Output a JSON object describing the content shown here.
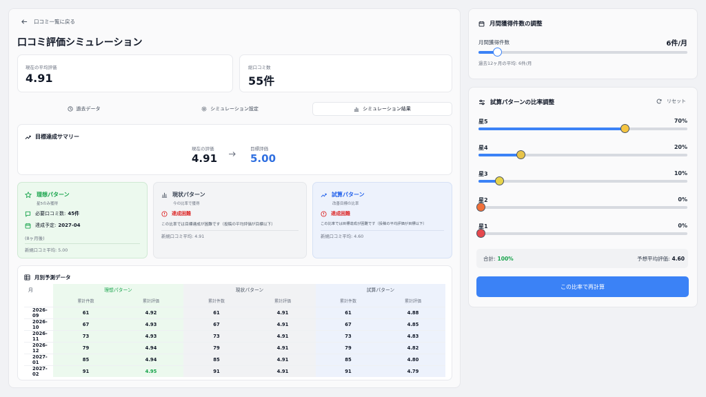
{
  "header": {
    "back_label": "口コミ一覧に戻る",
    "page_title": "口コミ評価シミュレーション"
  },
  "stats": {
    "avg_label": "現在の平均評価",
    "avg_value": "4.91",
    "total_label": "総口コミ数",
    "total_value": "55件"
  },
  "tabs": [
    {
      "label": "過去データ",
      "icon": "history-icon"
    },
    {
      "label": "シミュレーション設定",
      "icon": "gear-icon"
    },
    {
      "label": "シミュレーション結果",
      "icon": "bar-chart-icon",
      "active": true
    }
  ],
  "summary": {
    "title": "目標達成サマリー",
    "current_label": "現在の評価",
    "current_value": "4.91",
    "target_label": "目標評価",
    "target_value": "5.00"
  },
  "patterns": {
    "ideal": {
      "title": "理想パターン",
      "subtitle": "星5のみ獲得",
      "required_label": "必要口コミ数:",
      "required_value": "45件",
      "date_label": "達成予定:",
      "date_value": "2027-04",
      "months": "(8ヶ月後)",
      "new_avg": "新規口コミ平均: 5.00"
    },
    "current": {
      "title": "現状パターン",
      "subtitle": "今の比率で獲得",
      "status": "達成困難",
      "note": "この比率では目標達成が困難です（投稿の平均評価が目標以下）",
      "new_avg": "新規口コミ平均: 4.91"
    },
    "trial": {
      "title": "試算パターン",
      "subtitle": "改善目標の比率",
      "status": "達成困難",
      "note": "この比率では目標達成が困難です（投稿の平均評価が目標以下）",
      "new_avg": "新規口コミ平均: 4.60"
    }
  },
  "table": {
    "title": "月別予測データ",
    "month_header": "月",
    "groups": [
      "理想パターン",
      "現状パターン",
      "試算パターン"
    ],
    "sub_headers": [
      "累計件数",
      "累計評価"
    ],
    "rows": [
      {
        "month": "2026-09",
        "cells": [
          "61",
          "4.92",
          "61",
          "4.91",
          "61",
          "4.88"
        ]
      },
      {
        "month": "2026-10",
        "cells": [
          "67",
          "4.93",
          "67",
          "4.91",
          "67",
          "4.85"
        ]
      },
      {
        "month": "2026-11",
        "cells": [
          "73",
          "4.93",
          "73",
          "4.91",
          "73",
          "4.83"
        ]
      },
      {
        "month": "2026-12",
        "cells": [
          "79",
          "4.94",
          "79",
          "4.91",
          "79",
          "4.82"
        ]
      },
      {
        "month": "2027-01",
        "cells": [
          "85",
          "4.94",
          "85",
          "4.91",
          "85",
          "4.80"
        ]
      },
      {
        "month": "2027-02",
        "cells": [
          "91",
          "4.95",
          "91",
          "4.91",
          "91",
          "4.79"
        ]
      }
    ]
  },
  "monthly": {
    "title": "月間獲得件数の調整",
    "label": "月間獲得件数",
    "value": "6件/月",
    "slider_fraction": 0.09,
    "note": "過去12ヶ月の平均: 6件/月"
  },
  "ratio": {
    "title": "試算パターンの比率調整",
    "reset_label": "リセット",
    "stars": [
      {
        "label": "星5",
        "pct_label": "70%",
        "pct": 70,
        "thumb_color": "#f5c542"
      },
      {
        "label": "星4",
        "pct_label": "20%",
        "pct": 20,
        "thumb_color": "#e8c44a"
      },
      {
        "label": "星3",
        "pct_label": "10%",
        "pct": 10,
        "thumb_color": "#e8d44a"
      },
      {
        "label": "星2",
        "pct_label": "0%",
        "pct": 0,
        "thumb_color": "#f0703a"
      },
      {
        "label": "星1",
        "pct_label": "0%",
        "pct": 0,
        "thumb_color": "#e5484d"
      }
    ],
    "total_label": "合計:",
    "total_value": "100%",
    "expected_label": "予想平均評価:",
    "expected_value": "4.60",
    "recalc_label": "この比率で再計算"
  },
  "colors": {
    "accent": "#3b82f6",
    "success": "#16a34a",
    "danger": "#dc2626"
  }
}
